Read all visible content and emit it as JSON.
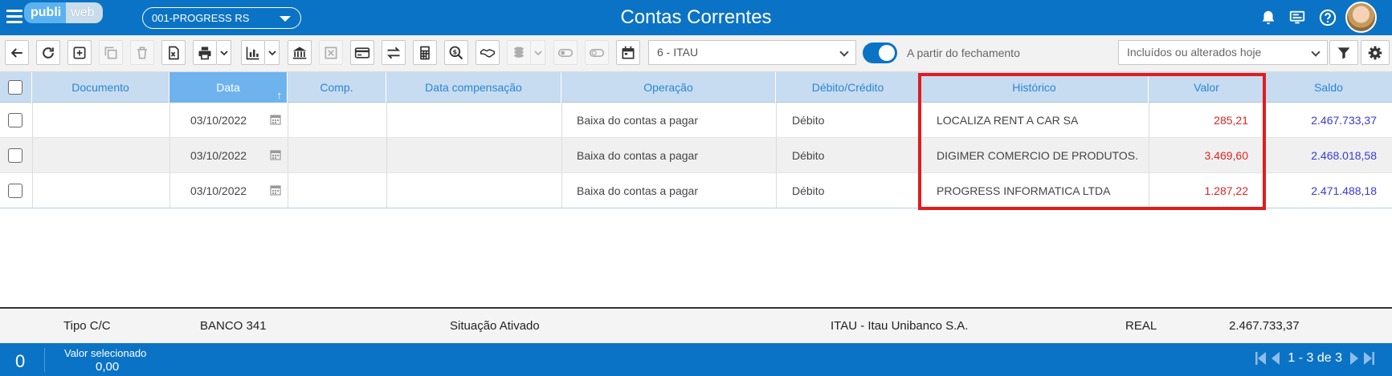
{
  "header": {
    "logo_part1": "publi",
    "logo_part2": "web",
    "company": "001-PROGRESS RS",
    "title": "Contas Correntes",
    "icons": [
      "menu-icon",
      "bell-icon",
      "monitor-icon",
      "help-icon",
      "user-avatar"
    ]
  },
  "toolbar": {
    "icons": [
      "back-arrow-icon",
      "refresh-icon",
      "add-icon",
      "copy-icon",
      "trash-icon",
      "excel-icon",
      "print-icon",
      "chart-icon",
      "bank-icon",
      "cancel-icon",
      "card-icon",
      "transfer-icon",
      "calculator-icon",
      "search-money-icon",
      "handshake-icon",
      "coins-icon",
      "toggle-off-icon",
      "toggle-off-icon",
      "calendar-icon",
      "filter-icon",
      "gear-icon"
    ],
    "bank_select": "6 - ITAU",
    "toggle_label": "A partir do fechamento",
    "toggle_on": true,
    "filter_select": "Incluídos ou alterados hoje"
  },
  "grid": {
    "columns": [
      "Documento",
      "Data",
      "Comp.",
      "Data compensação",
      "Operação",
      "Débito/Crédito",
      "Histórico",
      "Valor",
      "Saldo"
    ],
    "sorted_column": "Data",
    "sort_icon": "↑",
    "rows": [
      {
        "documento": "",
        "data": "03/10/2022",
        "comp": "",
        "data_compensacao": "",
        "operacao": "Baixa do contas a pagar",
        "debito_credito": "Débito",
        "historico": "LOCALIZA RENT A CAR SA",
        "valor": "285,21",
        "saldo": "2.467.733,37"
      },
      {
        "documento": "",
        "data": "03/10/2022",
        "comp": "",
        "data_compensacao": "",
        "operacao": "Baixa do contas a pagar",
        "debito_credito": "Débito",
        "historico": "DIGIMER COMERCIO DE PRODUTOS...",
        "valor": "3.469,60",
        "saldo": "2.468.018,58"
      },
      {
        "documento": "",
        "data": "03/10/2022",
        "comp": "",
        "data_compensacao": "",
        "operacao": "Baixa do contas a pagar",
        "debito_credito": "Débito",
        "historico": "PROGRESS INFORMATICA LTDA",
        "valor": "1.287,22",
        "saldo": "2.471.488,18"
      }
    ]
  },
  "info": {
    "tipo": "Tipo C/C",
    "banco": "BANCO 341",
    "situacao": "Situação Ativado",
    "instituicao": "ITAU - Itau Unibanco S.A.",
    "moeda": "REAL",
    "saldo": "2.467.733,37"
  },
  "status": {
    "count": "0",
    "selected_label": "Valor selecionado",
    "selected_value": "0,00",
    "pager": "1 - 3 de 3"
  },
  "colors": {
    "primary": "#0b73c5",
    "header_row": "#c7dcf0",
    "active_col": "#6fb3ee",
    "value_red": "#e02424",
    "balance_blue": "#3a3ad8",
    "highlight": "#e01d1d"
  }
}
